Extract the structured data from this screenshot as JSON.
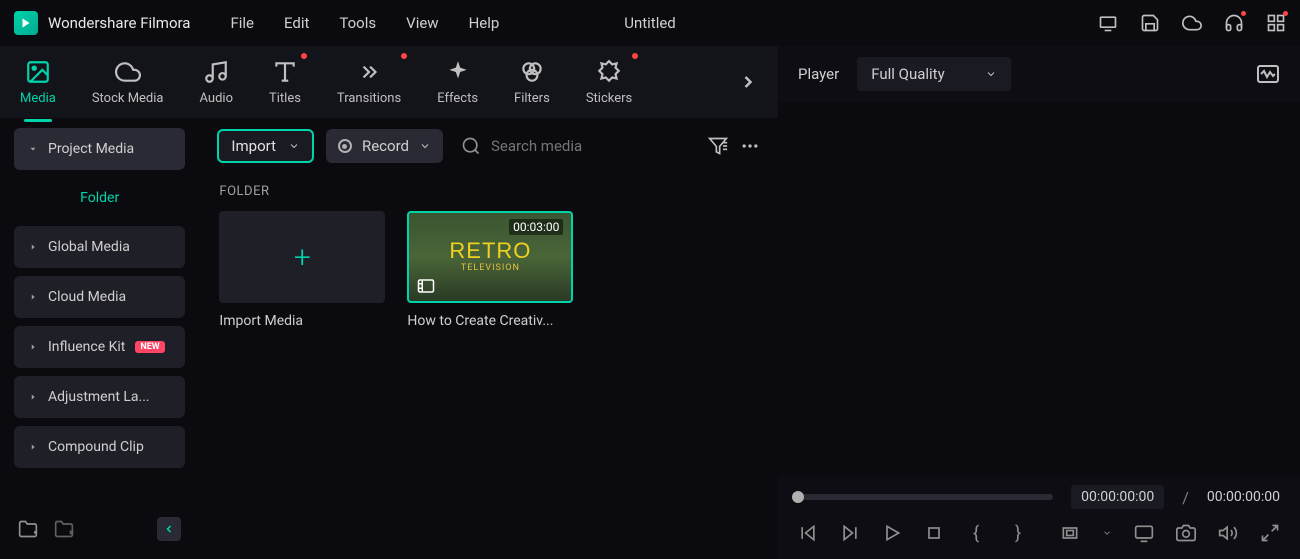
{
  "brand": "Wondershare Filmora",
  "menu": [
    "File",
    "Edit",
    "Tools",
    "View",
    "Help"
  ],
  "project_title": "Untitled",
  "tabs": [
    {
      "label": "Media",
      "active": true,
      "dot": false,
      "icon": "image"
    },
    {
      "label": "Stock Media",
      "active": false,
      "dot": false,
      "icon": "cloud-image"
    },
    {
      "label": "Audio",
      "active": false,
      "dot": false,
      "icon": "music"
    },
    {
      "label": "Titles",
      "active": false,
      "dot": true,
      "icon": "text"
    },
    {
      "label": "Transitions",
      "active": false,
      "dot": true,
      "icon": "transition"
    },
    {
      "label": "Effects",
      "active": false,
      "dot": false,
      "icon": "sparkle"
    },
    {
      "label": "Filters",
      "active": false,
      "dot": false,
      "icon": "filters"
    },
    {
      "label": "Stickers",
      "active": false,
      "dot": true,
      "icon": "sticker"
    }
  ],
  "sidebar": {
    "project_media": "Project Media",
    "folder": "Folder",
    "items": [
      {
        "label": "Global Media"
      },
      {
        "label": "Cloud Media"
      },
      {
        "label": "Influence Kit",
        "badge": "NEW"
      },
      {
        "label": "Adjustment La..."
      },
      {
        "label": "Compound Clip"
      }
    ]
  },
  "toolbar": {
    "import": "Import",
    "record": "Record",
    "search_placeholder": "Search media"
  },
  "folder_heading": "FOLDER",
  "media": [
    {
      "name": "Import Media",
      "type": "add"
    },
    {
      "name": "How to Create Creativ...",
      "type": "video",
      "duration": "00:03:00",
      "retro_title": "RETRO",
      "retro_sub": "TELEVISION"
    }
  ],
  "player": {
    "label": "Player",
    "quality": "Full Quality",
    "current": "00:00:00:00",
    "total": "00:00:00:00",
    "sep": "/"
  }
}
